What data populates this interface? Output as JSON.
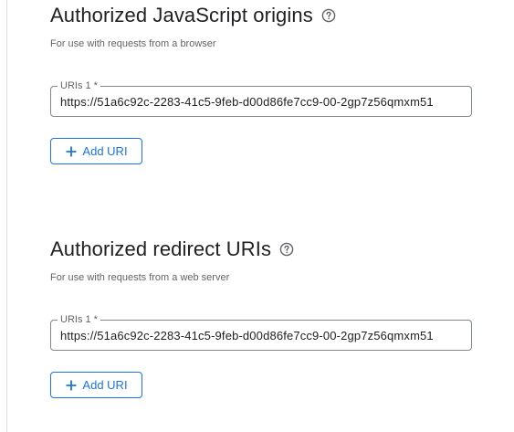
{
  "colors": {
    "accent": "#1a73e8",
    "text_primary": "#202124",
    "text_secondary": "#5f6368",
    "border": "#80868b"
  },
  "js_origins": {
    "title": "Authorized JavaScript origins",
    "help_icon": "help-circle-icon",
    "subtitle": "For use with requests from a browser",
    "uri_field": {
      "label": "URIs 1 *",
      "value": "https://51a6c92c-2283-41c5-9feb-d00d86fe7cc9-00-2gp7z56qmxm51"
    },
    "add_button": {
      "icon": "plus-icon",
      "label": "Add URI"
    }
  },
  "redirect_uris": {
    "title": "Authorized redirect URIs",
    "help_icon": "help-circle-icon",
    "subtitle": "For use with requests from a web server",
    "uri_field": {
      "label": "URIs 1 *",
      "value": "https://51a6c92c-2283-41c5-9feb-d00d86fe7cc9-00-2gp7z56qmxm51"
    },
    "add_button": {
      "icon": "plus-icon",
      "label": "Add URI"
    }
  }
}
